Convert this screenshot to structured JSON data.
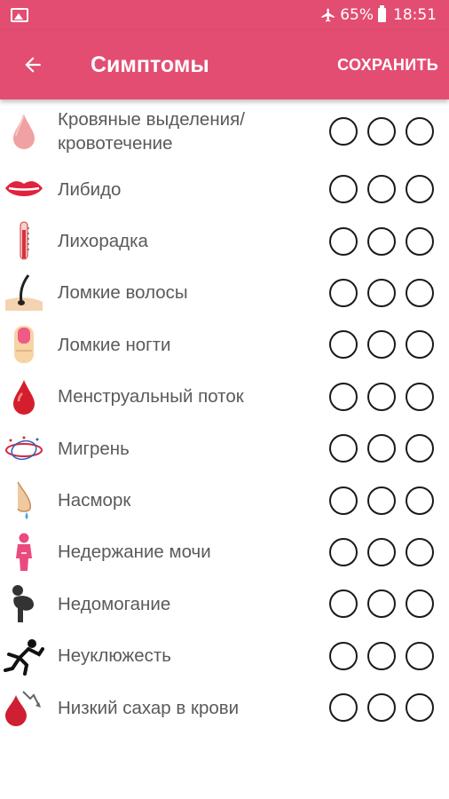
{
  "status": {
    "battery": "65%",
    "time": "18:51"
  },
  "appbar": {
    "title": "Симптомы",
    "save": "СОХРАНИТЬ"
  },
  "symptoms": [
    {
      "label": "Кровяные выделения/ кровотечение",
      "icon": "blood-drop-pale-icon"
    },
    {
      "label": "Либидо",
      "icon": "lips-icon"
    },
    {
      "label": "Лихорадка",
      "icon": "thermometer-icon"
    },
    {
      "label": "Ломкие волосы",
      "icon": "hair-icon"
    },
    {
      "label": "Ломкие ногти",
      "icon": "nail-icon"
    },
    {
      "label": "Менструальный поток",
      "icon": "blood-drop-icon"
    },
    {
      "label": "Мигрень",
      "icon": "migraine-icon"
    },
    {
      "label": "Насморк",
      "icon": "runny-nose-icon"
    },
    {
      "label": "Недержание мочи",
      "icon": "incontinence-icon"
    },
    {
      "label": "Недомогание",
      "icon": "malaise-icon"
    },
    {
      "label": "Неуклюжесть",
      "icon": "clumsiness-icon"
    },
    {
      "label": "Низкий сахар в крови",
      "icon": "low-blood-sugar-icon"
    }
  ],
  "colors": {
    "accent": "#e34d72",
    "text": "#5a5a5a"
  }
}
